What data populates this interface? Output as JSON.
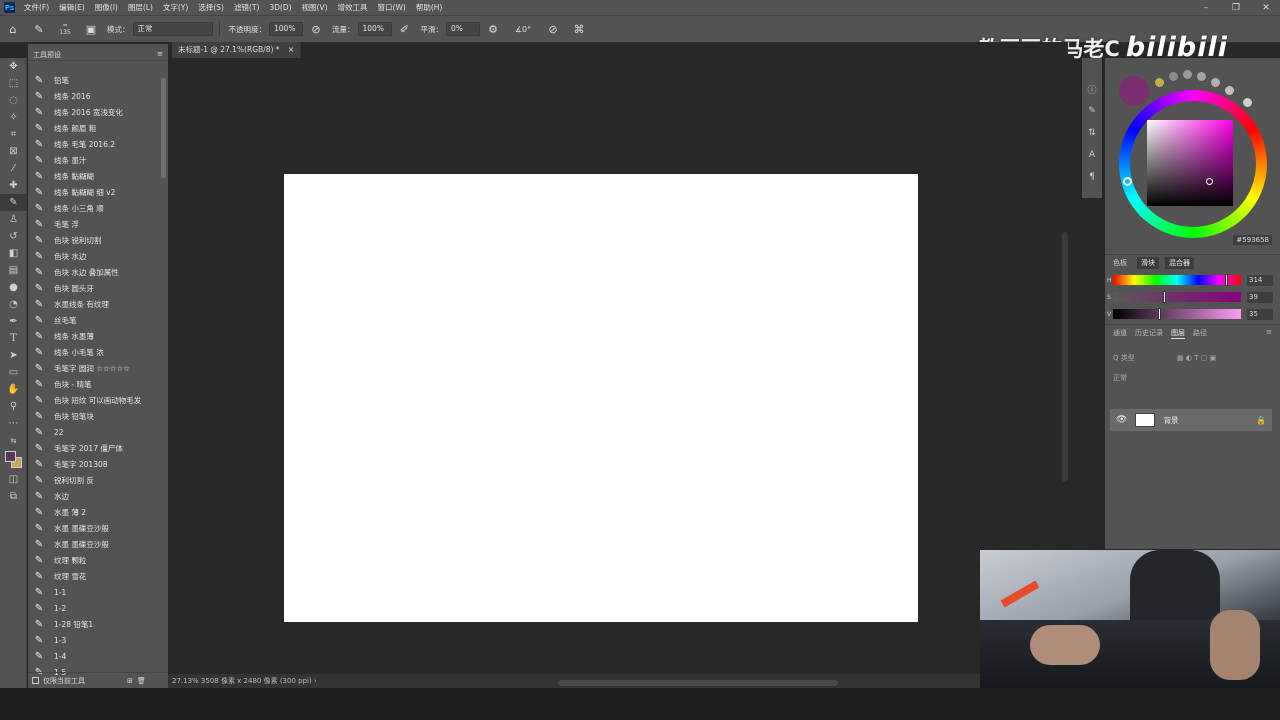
{
  "menubar": {
    "app_icon": "Ps",
    "items": [
      "文件(F)",
      "编辑(E)",
      "图像(I)",
      "图层(L)",
      "文字(Y)",
      "选择(S)",
      "滤镜(T)",
      "3D(D)",
      "视图(V)",
      "增效工具",
      "窗口(W)",
      "帮助(H)"
    ]
  },
  "options": {
    "mode_label": "模式：",
    "mode_value": "正常",
    "opacity_label": "不透明度：",
    "opacity_value": "100%",
    "flow_label": "流量：",
    "flow_value": "100%",
    "smoothing_label": "平滑：",
    "smoothing_value": "0%",
    "angle_value": "0°",
    "brush_size": "135"
  },
  "watermark": {
    "text": "教画画的马老C",
    "logo": "bilibili"
  },
  "presets": {
    "title": "工具预设",
    "items": [
      "铅笔",
      "线条 2016",
      "线条 2016 宽浅变化",
      "线条 颜眉 粗",
      "线条 毛笔 2016.2",
      "线条 墨汁",
      "线条 黏糊糊",
      "线条 黏糊糊 细 v2",
      "线条 小三角 顺",
      "毛笔 浮",
      "色块 锐利切割",
      "色块 水边",
      "色块 水边 叠加属性",
      "色块 圆头牙",
      "水墨线条 有纹理",
      "丝毛笔",
      "线条 水墨薄",
      "线条 小毛笔 浓",
      "毛笔字 圆润 ☆☆☆☆☆",
      "色块 - 晴笔",
      "色块 短纹 可以画动物毛发",
      "色块 铅笔块",
      "22",
      "毛笔字 2017 僵尸体",
      "毛笔字 201308",
      "锐利切割 反",
      "水边",
      "水墨 薄 2",
      "水墨 墨碟豆沙般",
      "水墨 墨碟豆沙般",
      "纹理 颗粒",
      "纹理 雪花",
      "1-1",
      "1-2",
      "1-28 铅笔1",
      "1-3",
      "1-4",
      "1-5"
    ],
    "footer_label": "仅限当前工具"
  },
  "document": {
    "tab_title": "未标题-1 @ 27.1%(RGB/8) *",
    "status": "27.13%   3508 像素 x 2480 像素 (300 ppi)   ›"
  },
  "color_panel": {
    "hex": "593658",
    "tabs": [
      "色板",
      "滑块",
      "混合器"
    ],
    "h_value": "314",
    "s_value": "39",
    "v_value": "35",
    "h_letter": "H",
    "s_letter": "S",
    "v_letter": "V",
    "h_fraction": 0.872,
    "s_fraction": 0.39,
    "v_fraction": 0.35
  },
  "layers": {
    "tabs": [
      "通道",
      "历史记录",
      "图层",
      "路径"
    ],
    "filter_placeholder": "Q 类型",
    "mode": "正常",
    "layer_name": "背景"
  },
  "colors": {
    "foreground": "#593658",
    "background": "#c9a85b",
    "accent": "#ff00ea"
  }
}
